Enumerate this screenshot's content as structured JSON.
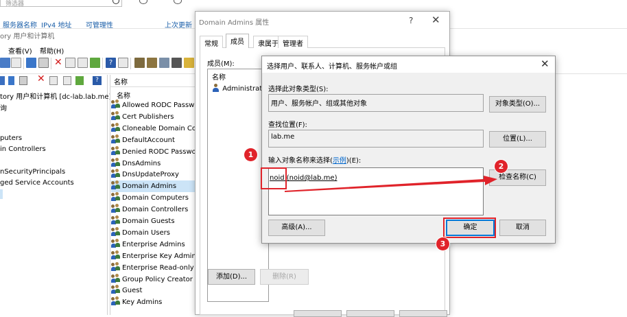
{
  "background": {
    "search_placeholder": "筛选器",
    "columns": [
      "服务器名称",
      "IPv4 地址",
      "可管理性",
      "上次更新"
    ]
  },
  "aduc": {
    "title": "ory 用户和计算机",
    "menu": [
      "查看(V)",
      "帮助(H)"
    ],
    "tree": [
      "tory 用户和计算机 [dc-lab.lab.me]",
      "询",
      "",
      "puters",
      "in Controllers",
      "",
      "nSecurityPrincipals",
      "ged Service Accounts"
    ],
    "list_header": "名称",
    "list_header2": "名称",
    "groups": [
      "Allowed RODC Password",
      "Cert Publishers",
      "Cloneable Domain Con",
      "DefaultAccount",
      "Denied RODC Password",
      "DnsAdmins",
      "DnsUpdateProxy",
      "Domain Admins",
      "Domain Computers",
      "Domain Controllers",
      "Domain Guests",
      "Domain Users",
      "Enterprise Admins",
      "Enterprise Key Admins",
      "Enterprise Read-only D",
      "Group Policy Creator O",
      "Guest",
      "Key Admins"
    ],
    "selected_group": "Domain Admins"
  },
  "properties_dialog": {
    "title": "Domain Admins 属性",
    "help_glyph": "?",
    "close_glyph": "✕",
    "tabs": [
      "常规",
      "成员",
      "隶属于",
      "管理者"
    ],
    "active_tab": "成员",
    "members_label": "成员(M):",
    "members_column": "名称",
    "members": [
      "Administrat..."
    ],
    "add_label": "添加(D)...",
    "remove_label": "删除(R)"
  },
  "select_dialog": {
    "title": "选择用户、联系人、计算机、服务帐户或组",
    "close_glyph": "✕",
    "object_types_label": "选择此对象类型(S):",
    "object_types_value": "用户、服务帐户、组或其他对象",
    "object_types_button": "对象类型(O)...",
    "location_label": "查找位置(F):",
    "location_value": "lab.me",
    "location_button": "位置(L)...",
    "names_label_pre": "输入对象名称来选择(",
    "names_label_link": "示例",
    "names_label_post": ")(E):",
    "names_value": "noid (noid@lab.me)",
    "check_names_button": "检查名称(C)",
    "advanced_button": "高级(A)...",
    "ok_button": "确定",
    "cancel_button": "取消"
  },
  "annotations": {
    "step1": "1",
    "step2": "2",
    "step3": "3",
    "accent_color": "#e0232a"
  }
}
